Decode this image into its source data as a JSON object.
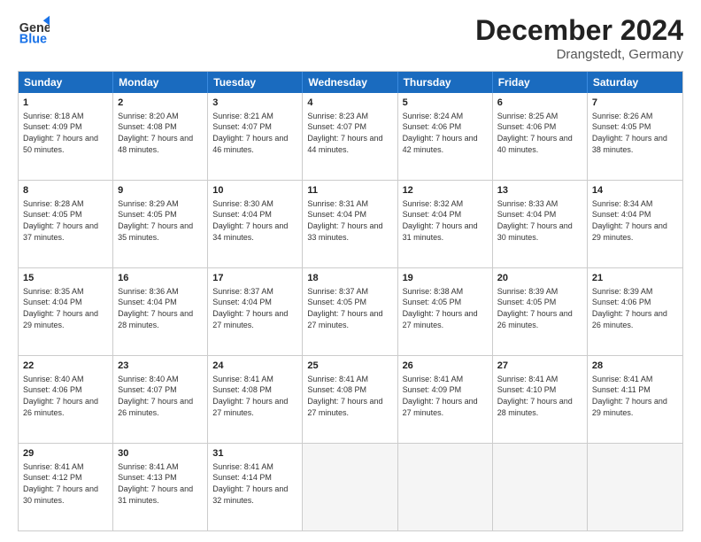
{
  "header": {
    "logo_line1": "General",
    "logo_line2": "Blue",
    "title": "December 2024",
    "subtitle": "Drangstedt, Germany"
  },
  "weekdays": [
    "Sunday",
    "Monday",
    "Tuesday",
    "Wednesday",
    "Thursday",
    "Friday",
    "Saturday"
  ],
  "weeks": [
    [
      {
        "day": "1",
        "sunrise": "Sunrise: 8:18 AM",
        "sunset": "Sunset: 4:09 PM",
        "daylight": "Daylight: 7 hours and 50 minutes."
      },
      {
        "day": "2",
        "sunrise": "Sunrise: 8:20 AM",
        "sunset": "Sunset: 4:08 PM",
        "daylight": "Daylight: 7 hours and 48 minutes."
      },
      {
        "day": "3",
        "sunrise": "Sunrise: 8:21 AM",
        "sunset": "Sunset: 4:07 PM",
        "daylight": "Daylight: 7 hours and 46 minutes."
      },
      {
        "day": "4",
        "sunrise": "Sunrise: 8:23 AM",
        "sunset": "Sunset: 4:07 PM",
        "daylight": "Daylight: 7 hours and 44 minutes."
      },
      {
        "day": "5",
        "sunrise": "Sunrise: 8:24 AM",
        "sunset": "Sunset: 4:06 PM",
        "daylight": "Daylight: 7 hours and 42 minutes."
      },
      {
        "day": "6",
        "sunrise": "Sunrise: 8:25 AM",
        "sunset": "Sunset: 4:06 PM",
        "daylight": "Daylight: 7 hours and 40 minutes."
      },
      {
        "day": "7",
        "sunrise": "Sunrise: 8:26 AM",
        "sunset": "Sunset: 4:05 PM",
        "daylight": "Daylight: 7 hours and 38 minutes."
      }
    ],
    [
      {
        "day": "8",
        "sunrise": "Sunrise: 8:28 AM",
        "sunset": "Sunset: 4:05 PM",
        "daylight": "Daylight: 7 hours and 37 minutes."
      },
      {
        "day": "9",
        "sunrise": "Sunrise: 8:29 AM",
        "sunset": "Sunset: 4:05 PM",
        "daylight": "Daylight: 7 hours and 35 minutes."
      },
      {
        "day": "10",
        "sunrise": "Sunrise: 8:30 AM",
        "sunset": "Sunset: 4:04 PM",
        "daylight": "Daylight: 7 hours and 34 minutes."
      },
      {
        "day": "11",
        "sunrise": "Sunrise: 8:31 AM",
        "sunset": "Sunset: 4:04 PM",
        "daylight": "Daylight: 7 hours and 33 minutes."
      },
      {
        "day": "12",
        "sunrise": "Sunrise: 8:32 AM",
        "sunset": "Sunset: 4:04 PM",
        "daylight": "Daylight: 7 hours and 31 minutes."
      },
      {
        "day": "13",
        "sunrise": "Sunrise: 8:33 AM",
        "sunset": "Sunset: 4:04 PM",
        "daylight": "Daylight: 7 hours and 30 minutes."
      },
      {
        "day": "14",
        "sunrise": "Sunrise: 8:34 AM",
        "sunset": "Sunset: 4:04 PM",
        "daylight": "Daylight: 7 hours and 29 minutes."
      }
    ],
    [
      {
        "day": "15",
        "sunrise": "Sunrise: 8:35 AM",
        "sunset": "Sunset: 4:04 PM",
        "daylight": "Daylight: 7 hours and 29 minutes."
      },
      {
        "day": "16",
        "sunrise": "Sunrise: 8:36 AM",
        "sunset": "Sunset: 4:04 PM",
        "daylight": "Daylight: 7 hours and 28 minutes."
      },
      {
        "day": "17",
        "sunrise": "Sunrise: 8:37 AM",
        "sunset": "Sunset: 4:04 PM",
        "daylight": "Daylight: 7 hours and 27 minutes."
      },
      {
        "day": "18",
        "sunrise": "Sunrise: 8:37 AM",
        "sunset": "Sunset: 4:05 PM",
        "daylight": "Daylight: 7 hours and 27 minutes."
      },
      {
        "day": "19",
        "sunrise": "Sunrise: 8:38 AM",
        "sunset": "Sunset: 4:05 PM",
        "daylight": "Daylight: 7 hours and 27 minutes."
      },
      {
        "day": "20",
        "sunrise": "Sunrise: 8:39 AM",
        "sunset": "Sunset: 4:05 PM",
        "daylight": "Daylight: 7 hours and 26 minutes."
      },
      {
        "day": "21",
        "sunrise": "Sunrise: 8:39 AM",
        "sunset": "Sunset: 4:06 PM",
        "daylight": "Daylight: 7 hours and 26 minutes."
      }
    ],
    [
      {
        "day": "22",
        "sunrise": "Sunrise: 8:40 AM",
        "sunset": "Sunset: 4:06 PM",
        "daylight": "Daylight: 7 hours and 26 minutes."
      },
      {
        "day": "23",
        "sunrise": "Sunrise: 8:40 AM",
        "sunset": "Sunset: 4:07 PM",
        "daylight": "Daylight: 7 hours and 26 minutes."
      },
      {
        "day": "24",
        "sunrise": "Sunrise: 8:41 AM",
        "sunset": "Sunset: 4:08 PM",
        "daylight": "Daylight: 7 hours and 27 minutes."
      },
      {
        "day": "25",
        "sunrise": "Sunrise: 8:41 AM",
        "sunset": "Sunset: 4:08 PM",
        "daylight": "Daylight: 7 hours and 27 minutes."
      },
      {
        "day": "26",
        "sunrise": "Sunrise: 8:41 AM",
        "sunset": "Sunset: 4:09 PM",
        "daylight": "Daylight: 7 hours and 27 minutes."
      },
      {
        "day": "27",
        "sunrise": "Sunrise: 8:41 AM",
        "sunset": "Sunset: 4:10 PM",
        "daylight": "Daylight: 7 hours and 28 minutes."
      },
      {
        "day": "28",
        "sunrise": "Sunrise: 8:41 AM",
        "sunset": "Sunset: 4:11 PM",
        "daylight": "Daylight: 7 hours and 29 minutes."
      }
    ],
    [
      {
        "day": "29",
        "sunrise": "Sunrise: 8:41 AM",
        "sunset": "Sunset: 4:12 PM",
        "daylight": "Daylight: 7 hours and 30 minutes."
      },
      {
        "day": "30",
        "sunrise": "Sunrise: 8:41 AM",
        "sunset": "Sunset: 4:13 PM",
        "daylight": "Daylight: 7 hours and 31 minutes."
      },
      {
        "day": "31",
        "sunrise": "Sunrise: 8:41 AM",
        "sunset": "Sunset: 4:14 PM",
        "daylight": "Daylight: 7 hours and 32 minutes."
      },
      {
        "day": "",
        "sunrise": "",
        "sunset": "",
        "daylight": ""
      },
      {
        "day": "",
        "sunrise": "",
        "sunset": "",
        "daylight": ""
      },
      {
        "day": "",
        "sunrise": "",
        "sunset": "",
        "daylight": ""
      },
      {
        "day": "",
        "sunrise": "",
        "sunset": "",
        "daylight": ""
      }
    ]
  ]
}
